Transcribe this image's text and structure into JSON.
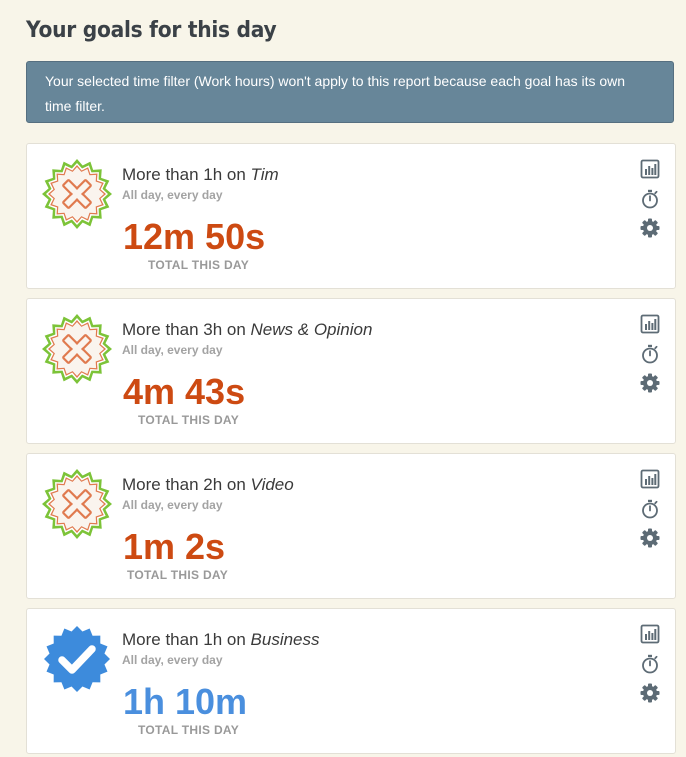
{
  "page": {
    "title": "Your goals for this day",
    "notice": "Your selected time filter (Work hours) won't apply to this report because each goal has its own time filter."
  },
  "colors": {
    "fail_value": "#cd4a12",
    "success_value": "#4a8fde",
    "fail_badge_outer": "#7cc338",
    "fail_badge_inner": "#e07a4f",
    "success_badge": "#3d8bdc",
    "icon": "#5d6b75"
  },
  "goals": [
    {
      "prefix": "More than 1h on ",
      "category": "Tim",
      "schedule": "All day, every day",
      "value": "12m 50s",
      "caption": "TOTAL THIS DAY",
      "status": "failed",
      "icons": [
        "bar-chart-icon",
        "stopwatch-icon",
        "gear-icon"
      ]
    },
    {
      "prefix": "More than 3h on ",
      "category": "News & Opinion",
      "schedule": "All day, every day",
      "value": "4m 43s",
      "caption": "TOTAL THIS DAY",
      "status": "failed",
      "icons": [
        "bar-chart-icon",
        "stopwatch-icon",
        "gear-icon"
      ]
    },
    {
      "prefix": "More than 2h on ",
      "category": "Video",
      "schedule": "All day, every day",
      "value": "1m 2s",
      "caption": "TOTAL THIS DAY",
      "status": "failed",
      "icons": [
        "bar-chart-icon",
        "stopwatch-icon",
        "gear-icon"
      ]
    },
    {
      "prefix": "More than 1h on ",
      "category": "Business",
      "schedule": "All day, every day",
      "value": "1h 10m",
      "caption": "TOTAL THIS DAY",
      "status": "achieved",
      "icons": [
        "bar-chart-icon",
        "stopwatch-icon",
        "gear-icon"
      ]
    }
  ]
}
